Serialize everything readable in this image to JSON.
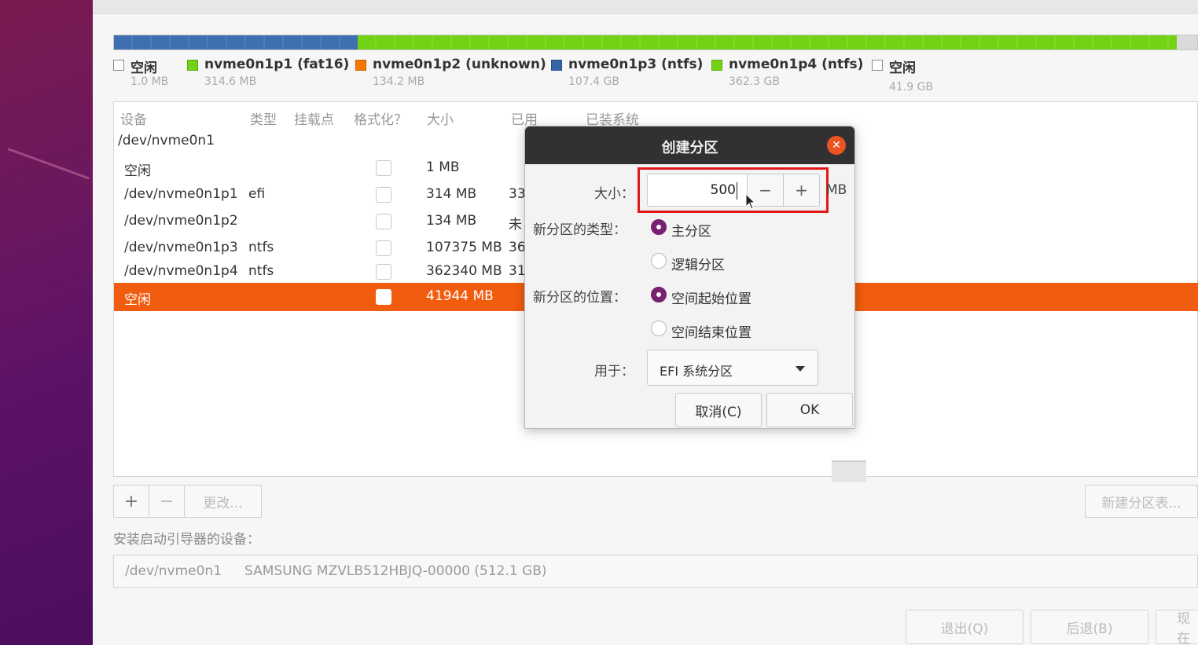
{
  "legend": [
    {
      "name": "空闲",
      "size": "1.0 MB",
      "color": "#ffffff"
    },
    {
      "name": "nvme0n1p1 (fat16)",
      "size": "314.6 MB",
      "color": "#73d216"
    },
    {
      "name": "nvme0n1p2 (unknown)",
      "size": "134.2 MB",
      "color": "#f57900"
    },
    {
      "name": "nvme0n1p3 (ntfs)",
      "size": "107.4 GB",
      "color": "#3465a4"
    },
    {
      "name": "nvme0n1p4 (ntfs)",
      "size": "362.3 GB",
      "color": "#73d216"
    },
    {
      "name": "空闲",
      "size": "41.9 GB",
      "color": "#ffffff"
    }
  ],
  "table": {
    "headers": [
      "设备",
      "类型",
      "挂载点",
      "格式化？",
      "大小",
      "已用",
      "已装系统"
    ],
    "device_group": "/dev/nvme0n1",
    "rows": [
      {
        "device": "空闲",
        "type": "",
        "size": "1 MB",
        "used": ""
      },
      {
        "device": "/dev/nvme0n1p1",
        "type": "efi",
        "size": "314 MB",
        "used": "33"
      },
      {
        "device": "/dev/nvme0n1p2",
        "type": "",
        "size": "134 MB",
        "used": "未"
      },
      {
        "device": "/dev/nvme0n1p3",
        "type": "ntfs",
        "size": "107375 MB",
        "used": "36"
      },
      {
        "device": "/dev/nvme0n1p4",
        "type": "ntfs",
        "size": "362340 MB",
        "used": "31"
      },
      {
        "device": "空闲",
        "type": "",
        "size": "41944 MB",
        "used": ""
      }
    ],
    "selected_row_index": 5
  },
  "toolbar": {
    "add": "+",
    "remove": "−",
    "change": "更改...",
    "new_table": "新建分区表..."
  },
  "boot": {
    "label": "安装启动引导器的设备：",
    "device": "/dev/nvme0n1",
    "model": "SAMSUNG MZVLB512HBJQ-00000 (512.1 GB)"
  },
  "bottom_buttons": {
    "quit": "退出(Q)",
    "back": "后退(B)",
    "install_now": "现在"
  },
  "dialog": {
    "title": "创建分区",
    "size_label": "大小：",
    "size_value": "500",
    "size_unit": "MB",
    "minus": "−",
    "plus": "+",
    "type_label": "新分区的类型：",
    "type_primary": "主分区",
    "type_logical": "逻辑分区",
    "location_label": "新分区的位置：",
    "location_start": "空间起始位置",
    "location_end": "空间结束位置",
    "use_label": "用于：",
    "use_value": "EFI 系统分区",
    "cancel": "取消(C)",
    "ok": "OK",
    "type_selected": "primary",
    "location_selected": "start"
  },
  "colors": {
    "accent_orange": "#f25c0f",
    "radio_purple": "#77216f",
    "highlight_red": "#e21818",
    "dialog_header": "#313131"
  }
}
